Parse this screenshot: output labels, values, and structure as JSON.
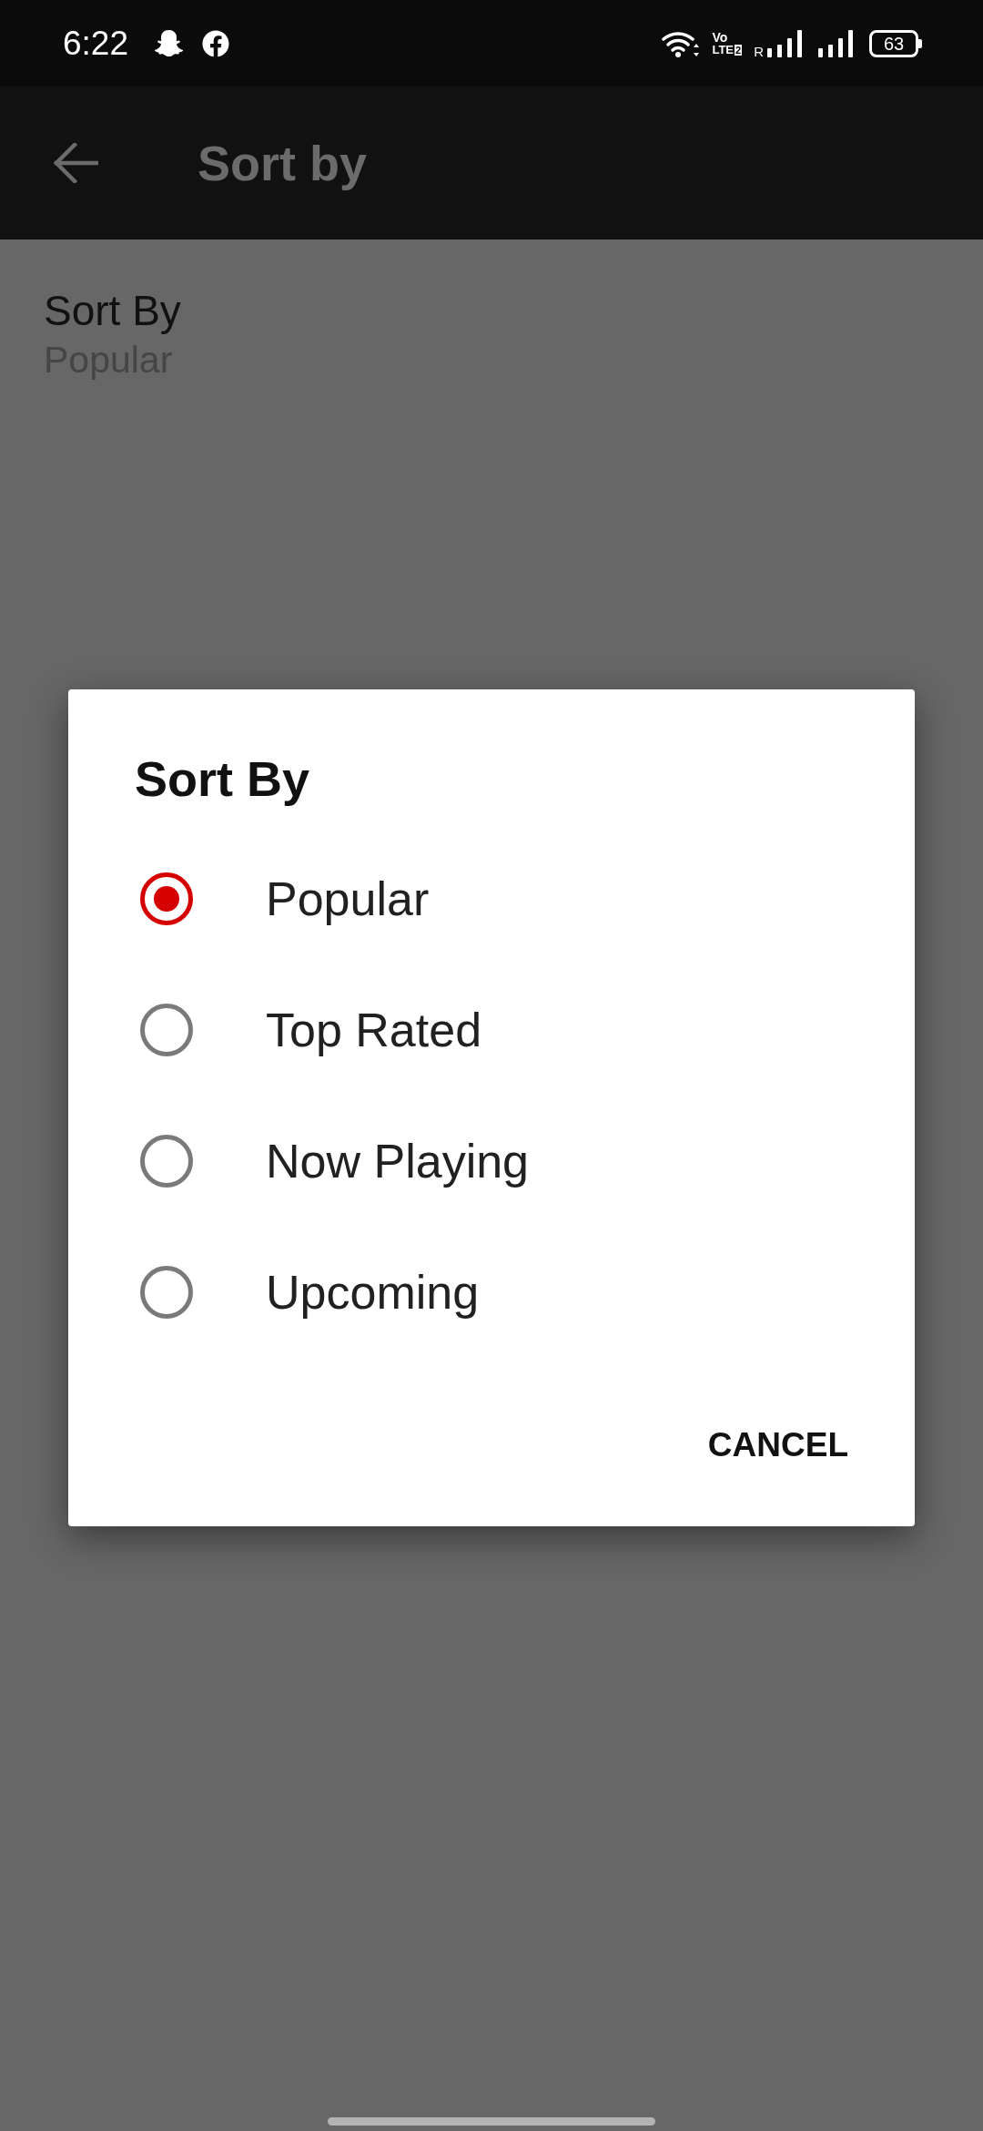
{
  "status_bar": {
    "time": "6:22",
    "volte": {
      "top": "Vo",
      "bottom": "LTE",
      "sim": "2"
    },
    "roaming": "R",
    "battery": "63"
  },
  "app_bar": {
    "title": "Sort by"
  },
  "setting": {
    "title": "Sort By",
    "value": "Popular"
  },
  "dialog": {
    "title": "Sort By",
    "options": [
      {
        "label": "Popular",
        "selected": true
      },
      {
        "label": "Top Rated",
        "selected": false
      },
      {
        "label": "Now Playing",
        "selected": false
      },
      {
        "label": "Upcoming",
        "selected": false
      }
    ],
    "buttons": [
      "CANCEL"
    ]
  }
}
